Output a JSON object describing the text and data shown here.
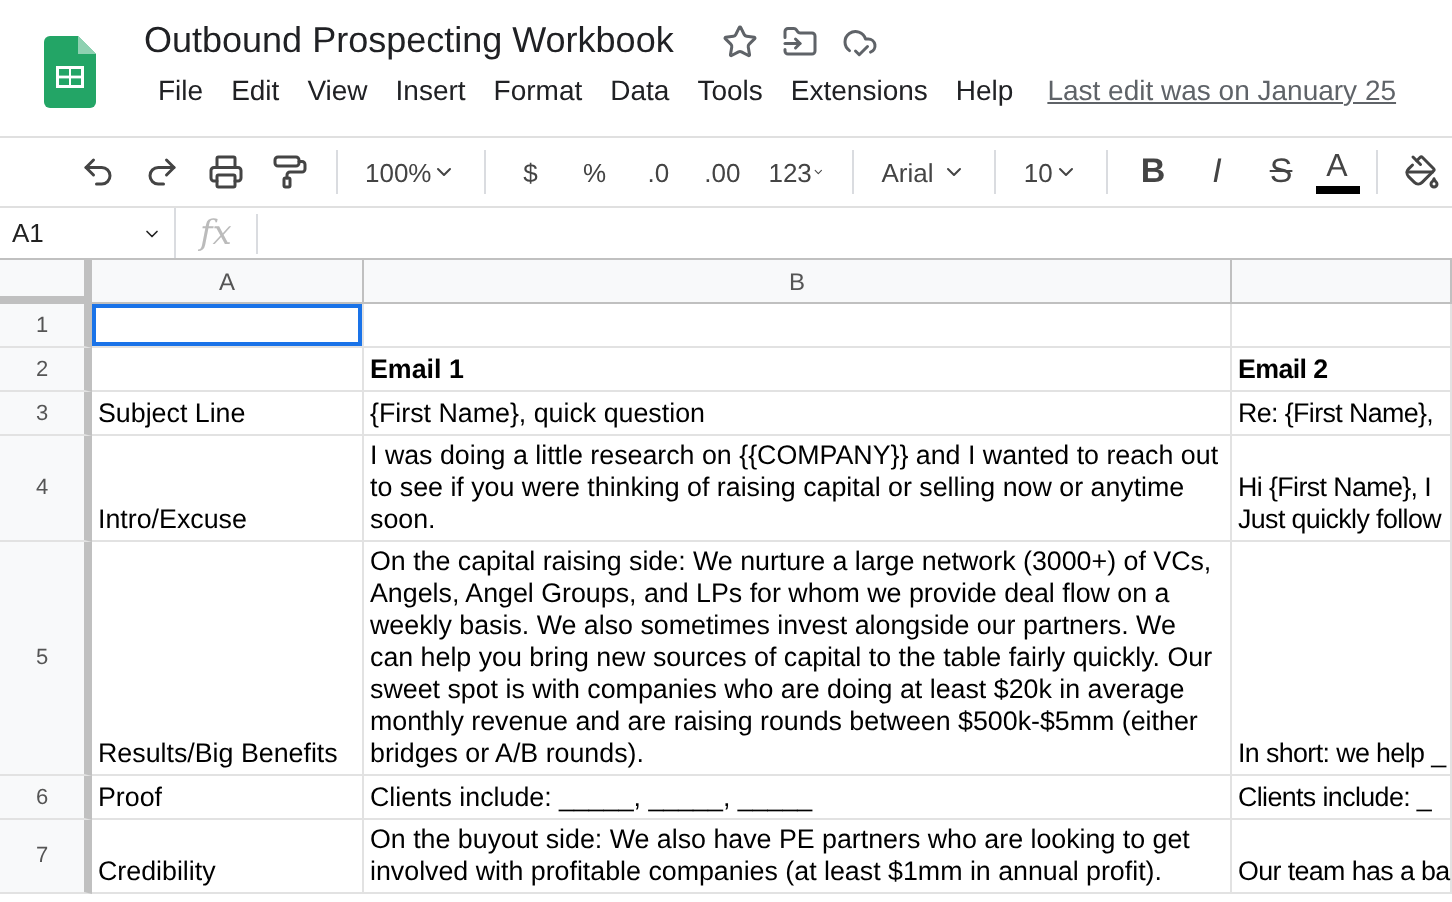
{
  "document": {
    "title": "Outbound Prospecting Workbook",
    "last_edit": "Last edit was on January 25"
  },
  "menu": [
    "File",
    "Edit",
    "View",
    "Insert",
    "Format",
    "Data",
    "Tools",
    "Extensions",
    "Help"
  ],
  "toolbar": {
    "zoom": "100%",
    "currency": "$",
    "percent": "%",
    "decrease_decimals": ".0",
    "increase_decimals": ".00",
    "more_formats": "123",
    "font": "Arial",
    "font_size": "10",
    "bold": "B",
    "italic": "I",
    "strikethrough": "S",
    "text_color": "A"
  },
  "formula_bar": {
    "cell_ref": "A1",
    "fx": "fx"
  },
  "sheet": {
    "columns": [
      "A",
      "B"
    ],
    "rows": [
      {
        "number": "1",
        "bold": false,
        "cells": [
          {
            "selected": true
          },
          {
            "selected": false
          },
          {
            "selected": false
          }
        ]
      },
      {
        "number": "2",
        "bold": true,
        "cells": [
          {
            "selected": false
          },
          {
            "text": "Email 1",
            "selected": false
          },
          {
            "text": "Email 2",
            "selected": false
          }
        ]
      },
      {
        "number": "3",
        "bold": false,
        "cells": [
          {
            "text": "Subject Line",
            "selected": false
          },
          {
            "text": "{First Name}, quick question",
            "selected": false
          },
          {
            "text": "Re: {First Name},",
            "selected": false
          }
        ]
      },
      {
        "number": "4",
        "bold": false,
        "cells": [
          {
            "text": "Intro/Excuse",
            "selected": false
          },
          {
            "text": "I was doing a little research on {{COMPANY}} and I wanted to reach out to see if you were thinking of raising capital or selling now or anytime soon.",
            "selected": false
          },
          {
            "text": "Hi {First Name}, I\nJust quickly follow",
            "selected": false
          }
        ]
      },
      {
        "number": "5",
        "bold": false,
        "cells": [
          {
            "text": "Results/Big Benefits",
            "selected": false
          },
          {
            "text": "On the capital raising side: We nurture a large network (3000+) of VCs, Angels, Angel Groups, and LPs for whom we provide deal flow on a weekly basis. We also sometimes invest alongside our partners. We can help you bring new sources of capital to the table fairly quickly. Our sweet spot is with companies who are doing at least $20k in average monthly revenue and are raising rounds between $500k-$5mm (either bridges or A/B rounds).",
            "selected": false
          },
          {
            "text": "In short: we help _",
            "selected": false
          }
        ]
      },
      {
        "number": "6",
        "bold": false,
        "cells": [
          {
            "text": "Proof",
            "selected": false
          },
          {
            "text": "Clients include: _____, _____, _____",
            "selected": false
          },
          {
            "text": "Clients include: _",
            "selected": false
          }
        ]
      },
      {
        "number": "7",
        "bold": false,
        "cells": [
          {
            "text": "Credibility",
            "selected": false
          },
          {
            "text": "On the buyout side: We also have PE partners who are looking to get involved with profitable companies (at least $1mm in annual profit).",
            "selected": false
          },
          {
            "text": "Our team has a ba",
            "selected": false
          }
        ]
      }
    ]
  }
}
